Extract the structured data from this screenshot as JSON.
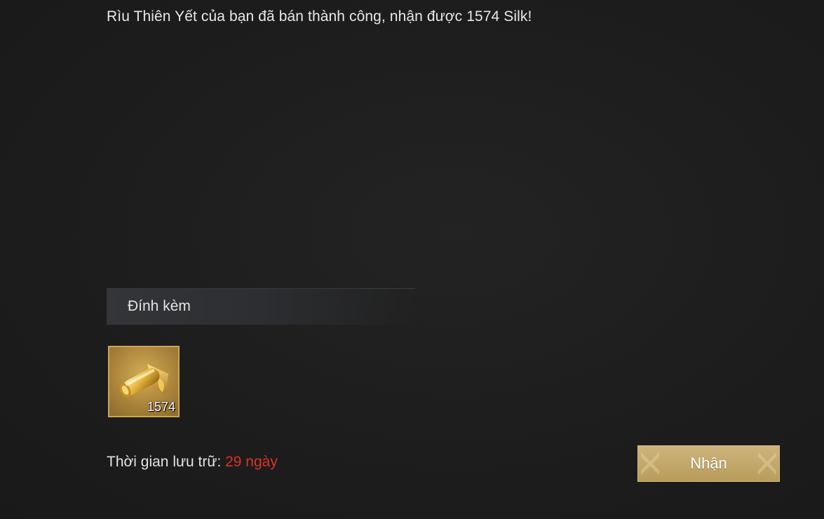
{
  "mail": {
    "body_text": "Rìu Thiên Yết của bạn đã bán thành công, nhận được 1574 Silk!"
  },
  "attachments": {
    "header": "Đính kèm",
    "items": [
      {
        "icon": "silk-scroll-icon",
        "count": "1574"
      }
    ]
  },
  "storage": {
    "label": "Thời gian lưu trữ: ",
    "value": "29 ngày",
    "value_color": "#d9332b"
  },
  "claim_button": {
    "label": "Nhận"
  }
}
